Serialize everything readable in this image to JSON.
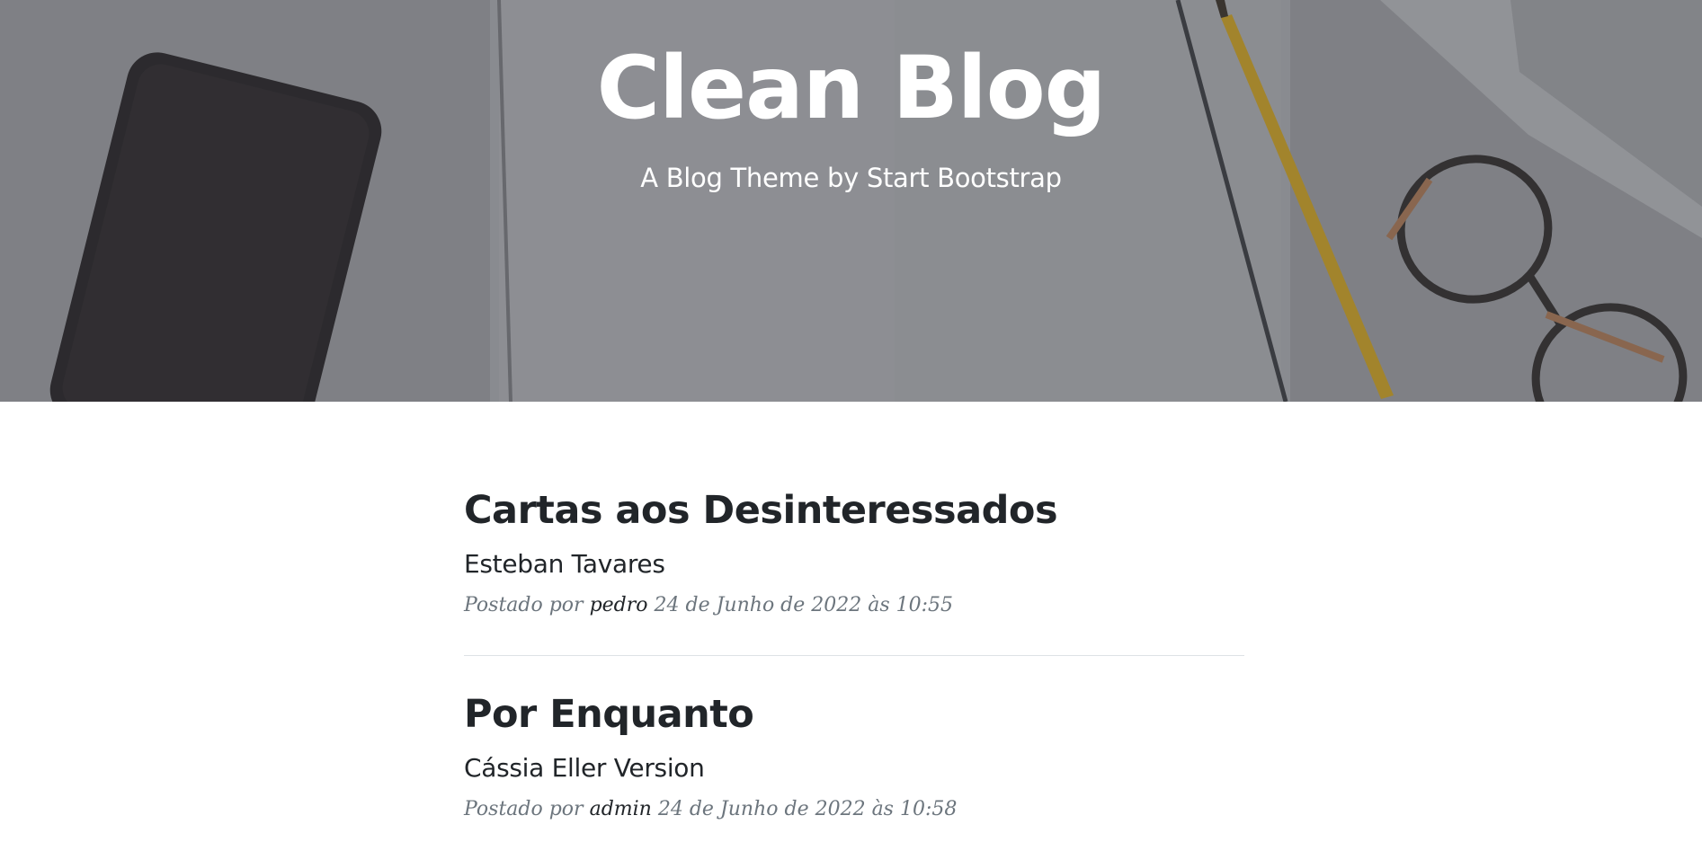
{
  "header": {
    "title": "Clean Blog",
    "subtitle": "A Blog Theme by Start Bootstrap"
  },
  "posts": [
    {
      "title": "Cartas aos Desinteressados",
      "subtitle": "Esteban Tavares",
      "meta_prefix": "Postado por",
      "author": "pedro",
      "date": "24 de Junho de 2022 às 10:55"
    },
    {
      "title": "Por Enquanto",
      "subtitle": "Cássia Eller Version",
      "meta_prefix": "Postado por",
      "author": "admin",
      "date": "24 de Junho de 2022 às 10:58"
    }
  ],
  "colors": {
    "text": "#212529",
    "muted": "#6c757d",
    "divider": "#dee2e6",
    "header_overlay": "#8e8f93"
  }
}
